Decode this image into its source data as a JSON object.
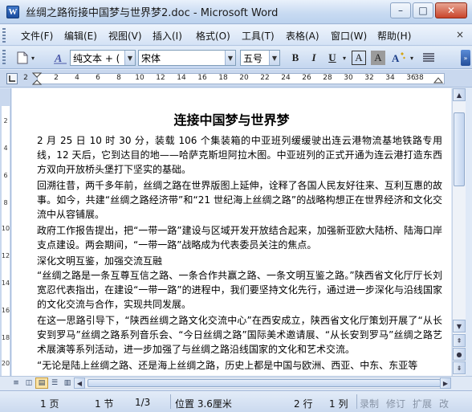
{
  "window": {
    "title": "丝绸之路衔接中国梦与世界梦2.doc - Microsoft Word",
    "app_icon_letter": "W",
    "minimize": "–",
    "maximize": "□",
    "close": "✕"
  },
  "menubar": {
    "items": [
      "文件(F)",
      "编辑(E)",
      "视图(V)",
      "插入(I)",
      "格式(O)",
      "工具(T)",
      "表格(A)",
      "窗口(W)",
      "帮助(H)"
    ],
    "close_doc": "×"
  },
  "toolbar": {
    "style_value": "纯文本 + (",
    "font_value": "宋体",
    "size_value": "五号",
    "bold": "B",
    "italic": "I",
    "underline": "U",
    "char_border": "A",
    "char_shading": "A"
  },
  "ruler": {
    "numbers": [
      "2",
      "2",
      "4",
      "6",
      "8",
      "10",
      "12",
      "14",
      "16",
      "18",
      "20",
      "22",
      "24",
      "26",
      "28",
      "30",
      "32",
      "34",
      "36",
      "38"
    ]
  },
  "vruler": {
    "numbers": [
      "2",
      "4",
      "6",
      "8",
      "10",
      "12",
      "14",
      "16",
      "18",
      "20"
    ]
  },
  "document": {
    "title": "连接中国梦与世界梦",
    "paragraphs": [
      "2 月 25 日 10 时 30 分，装载 106 个集装箱的中亚班列缓缓驶出连云港物流基地铁路专用线，12 天后，它到达目的地——哈萨克斯坦阿拉木图。中亚班列的正式开通为连云港打造东西方双向开放桥头堡打下坚实的基础。",
      "回溯往昔，两千多年前，丝绸之路在世界版图上延伸，诠释了各国人民友好往来、互利互惠的故事。如今，共建“丝绸之路经济带”和“21 世纪海上丝绸之路”的战略构想正在世界经济和文化交流中从容铺展。",
      "政府工作报告提出，把“一带一路”建设与区域开发开放结合起来，加强新亚欧大陆桥、陆海口岸支点建设。两会期间，“一带一路”战略成为代表委员关注的焦点。",
      "深化文明互鉴，加强交流互融",
      "“丝绸之路是一条互尊互信之路、一条合作共赢之路、一条文明互鉴之路。”陕西省文化厅厅长刘宽忍代表指出，在建设“一带一路”的进程中，我们要坚持文化先行，通过进一步深化与沿线国家的文化交流与合作，实现共同发展。",
      "在这一思路引导下，“陕西丝绸之路文化交流中心”在西安成立，陕西省文化厅策划开展了“从长安到罗马”丝绸之路系列音乐会、“今日丝绸之路”国际美术邀请展、“从长安到罗马”丝绸之路艺术展演等系列活动，进一步加强了与丝绸之路沿线国家的文化和艺术交流。",
      "“无论是陆上丝绸之路、还是海上丝绸之路，历史上都是中国与欧洲、西亚、中东、东亚等"
    ]
  },
  "statusbar": {
    "page": "1 页",
    "section": "1 节",
    "page_of": "1/3",
    "position": "位置 3.6厘米",
    "line": "2 行",
    "column": "1 列",
    "rec": "录制",
    "trk": "修订",
    "ext": "扩展",
    "ovr": "改"
  }
}
